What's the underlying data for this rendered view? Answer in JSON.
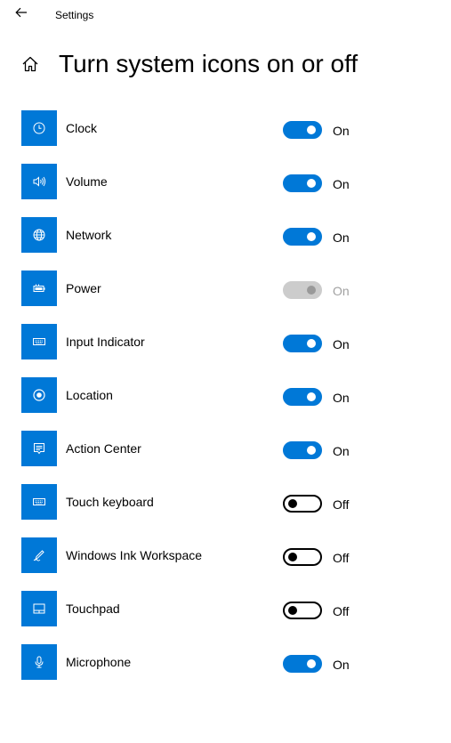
{
  "titlebar": {
    "back_icon": "back-arrow-icon",
    "app_title": "Settings"
  },
  "header": {
    "home_icon": "home-icon",
    "title": "Turn system icons on or off"
  },
  "colors": {
    "accent": "#0078d7",
    "toggle_off_border": "#000000",
    "disabled": "#cccccc",
    "disabled_text": "#a0a0a0"
  },
  "items": [
    {
      "label": "Clock",
      "icon": "clock-icon",
      "state": "On",
      "on": true,
      "disabled": false
    },
    {
      "label": "Volume",
      "icon": "volume-icon",
      "state": "On",
      "on": true,
      "disabled": false
    },
    {
      "label": "Network",
      "icon": "globe-icon",
      "state": "On",
      "on": true,
      "disabled": false
    },
    {
      "label": "Power",
      "icon": "battery-icon",
      "state": "On",
      "on": true,
      "disabled": true
    },
    {
      "label": "Input Indicator",
      "icon": "keyboard-icon",
      "state": "On",
      "on": true,
      "disabled": false
    },
    {
      "label": "Location",
      "icon": "location-icon",
      "state": "On",
      "on": true,
      "disabled": false
    },
    {
      "label": "Action Center",
      "icon": "action-center-icon",
      "state": "On",
      "on": true,
      "disabled": false
    },
    {
      "label": "Touch keyboard",
      "icon": "touch-keyboard-icon",
      "state": "Off",
      "on": false,
      "disabled": false
    },
    {
      "label": "Windows Ink Workspace",
      "icon": "pen-icon",
      "state": "Off",
      "on": false,
      "disabled": false
    },
    {
      "label": "Touchpad",
      "icon": "touchpad-icon",
      "state": "Off",
      "on": false,
      "disabled": false
    },
    {
      "label": "Microphone",
      "icon": "microphone-icon",
      "state": "On",
      "on": true,
      "disabled": false
    }
  ]
}
